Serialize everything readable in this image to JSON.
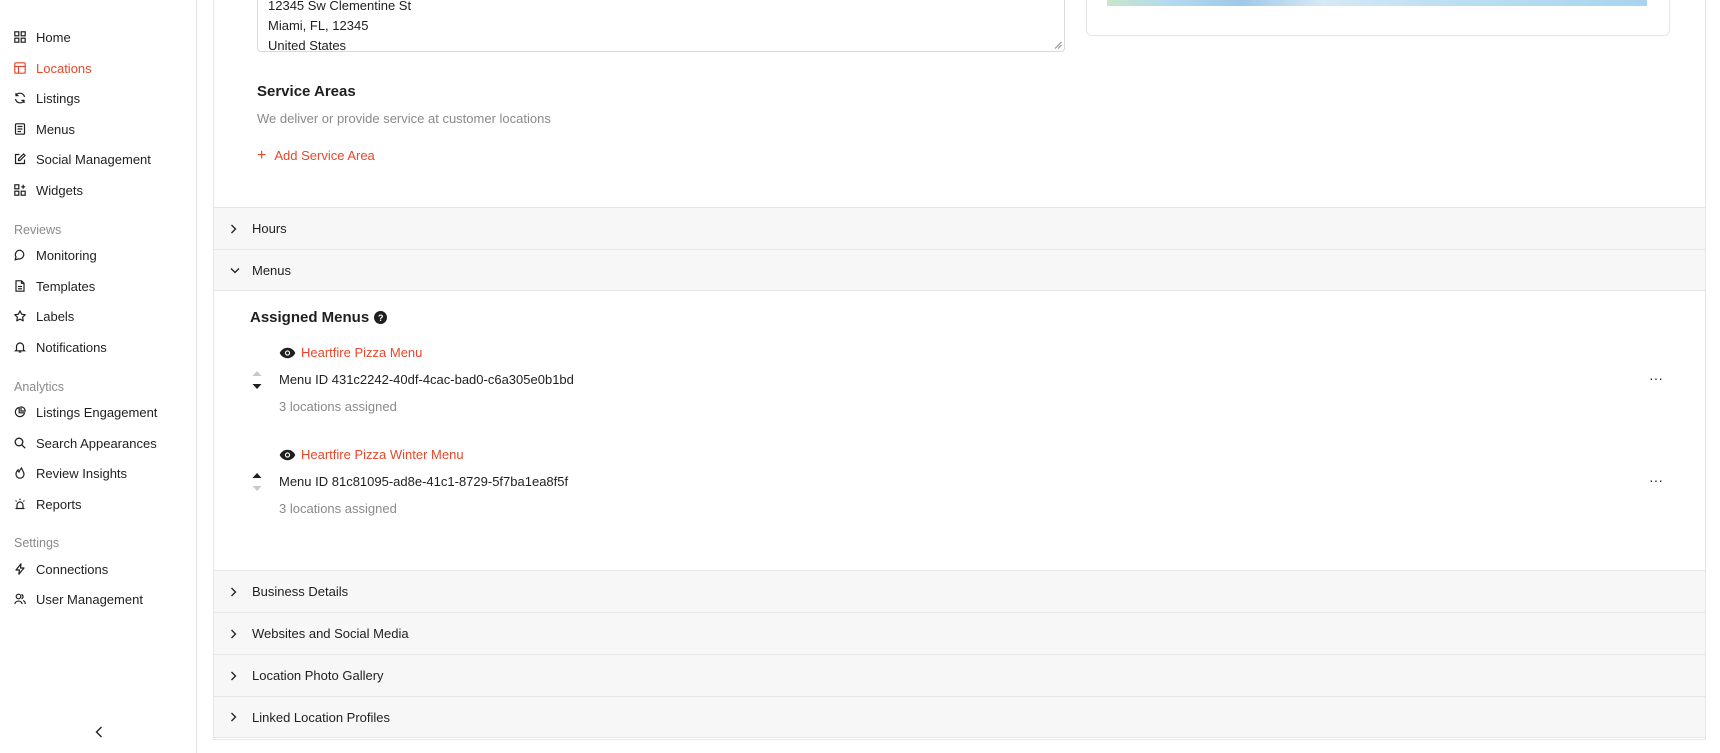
{
  "sidebar": {
    "main_items": [
      {
        "label": "Home",
        "icon": "grid-icon"
      },
      {
        "label": "Locations",
        "icon": "table-icon",
        "active": true
      },
      {
        "label": "Listings",
        "icon": "refresh-icon"
      },
      {
        "label": "Menus",
        "icon": "menu-doc-icon"
      },
      {
        "label": "Social Management",
        "icon": "edit-icon"
      },
      {
        "label": "Widgets",
        "icon": "widgets-icon"
      }
    ],
    "reviews_section": "Reviews",
    "reviews_items": [
      {
        "label": "Monitoring",
        "icon": "chat-icon"
      },
      {
        "label": "Templates",
        "icon": "document-icon"
      },
      {
        "label": "Labels",
        "icon": "star-icon"
      },
      {
        "label": "Notifications",
        "icon": "bell-icon"
      }
    ],
    "analytics_section": "Analytics",
    "analytics_items": [
      {
        "label": "Listings Engagement",
        "icon": "pie-chart-icon"
      },
      {
        "label": "Search Appearances",
        "icon": "search-icon"
      },
      {
        "label": "Review Insights",
        "icon": "flame-icon"
      },
      {
        "label": "Reports",
        "icon": "alarm-icon"
      }
    ],
    "settings_section": "Settings",
    "settings_items": [
      {
        "label": "Connections",
        "icon": "bolt-icon"
      },
      {
        "label": "User Management",
        "icon": "users-icon"
      }
    ]
  },
  "address": {
    "lines": [
      "12345 Sw Clementine St",
      "Miami, FL, 12345",
      "United States"
    ]
  },
  "service_areas": {
    "title": "Service Areas",
    "description": "We deliver or provide service at customer locations",
    "add_label": "Add Service Area"
  },
  "accordions": {
    "hours": "Hours",
    "menus": "Menus",
    "business_details": "Business Details",
    "websites": "Websites and Social Media",
    "photo_gallery": "Location Photo Gallery",
    "linked_profiles": "Linked Location Profiles"
  },
  "assigned_menus": {
    "title": "Assigned Menus",
    "items": [
      {
        "name": "Heartfire Pizza Menu",
        "menu_id": "Menu ID 431c2242-40df-4cac-bad0-c6a305e0b1bd",
        "assigned": "3 locations assigned"
      },
      {
        "name": "Heartfire Pizza Winter Menu",
        "menu_id": "Menu ID 81c81095-ad8e-41c1-8729-5f7ba1ea8f5f",
        "assigned": "3 locations assigned"
      }
    ]
  },
  "colors": {
    "accent": "#e8472b",
    "muted": "#8a8a8a",
    "header_bg": "#f7f7f7"
  }
}
